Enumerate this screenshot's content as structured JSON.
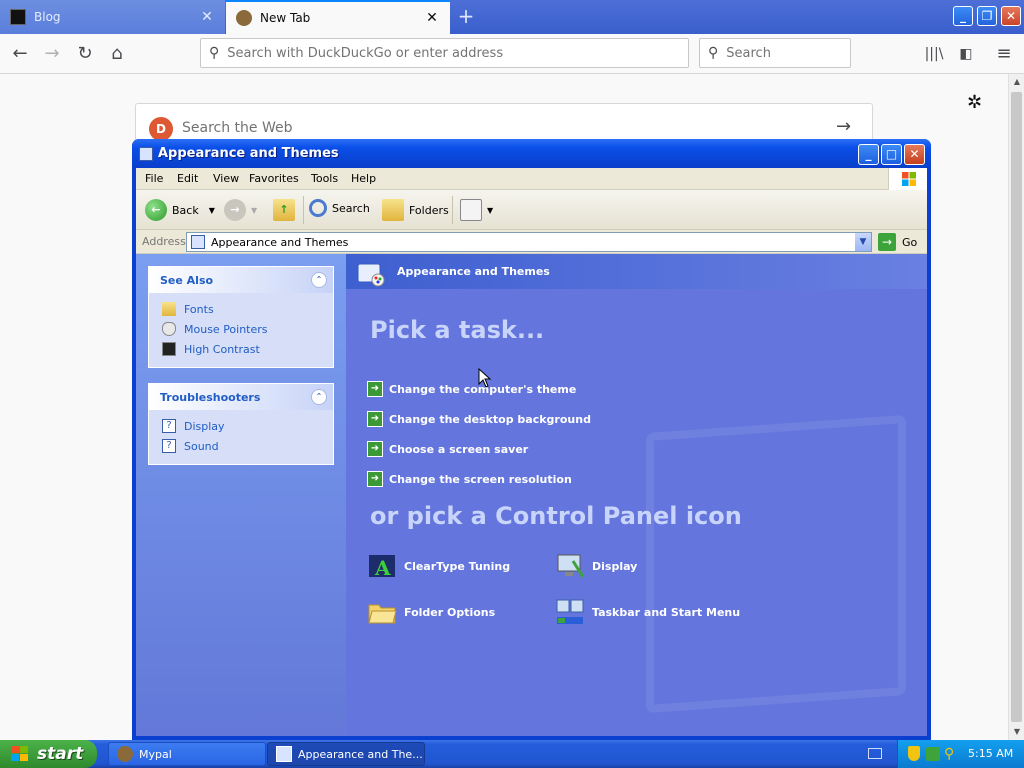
{
  "browser": {
    "tabs": [
      {
        "label": "Blog",
        "active": false
      },
      {
        "label": "New Tab",
        "active": true
      }
    ],
    "url_placeholder": "Search with DuckDuckGo or enter address",
    "search_placeholder": "Search",
    "page": {
      "search_placeholder": "Search the Web"
    }
  },
  "window": {
    "title": "Appearance and Themes",
    "menu": [
      "File",
      "Edit",
      "View",
      "Favorites",
      "Tools",
      "Help"
    ],
    "toolbar": {
      "back": "Back",
      "search": "Search",
      "folders": "Folders"
    },
    "address": {
      "label": "Address",
      "value": "Appearance and Themes",
      "go": "Go"
    },
    "see_also": {
      "title": "See Also",
      "items": [
        "Fonts",
        "Mouse Pointers",
        "High Contrast"
      ]
    },
    "troubleshooters": {
      "title": "Troubleshooters",
      "items": [
        "Display",
        "Sound"
      ]
    },
    "main": {
      "banner": "Appearance and Themes",
      "pick_task": "Pick a task...",
      "tasks": [
        "Change the computer's theme",
        "Change the desktop background",
        "Choose a screen saver",
        "Change the screen resolution"
      ],
      "pick_icon": "or pick a Control Panel icon",
      "icons": [
        "ClearType Tuning",
        "Display",
        "Folder Options",
        "Taskbar and Start Menu"
      ]
    }
  },
  "taskbar": {
    "start": "start",
    "buttons": [
      "Mypal",
      "Appearance and The..."
    ],
    "clock": "5:15 AM"
  },
  "colors": {
    "xp_blue": "#0a3fd0",
    "main_pane": "#6476dd",
    "start_green": "#3a9a38"
  }
}
